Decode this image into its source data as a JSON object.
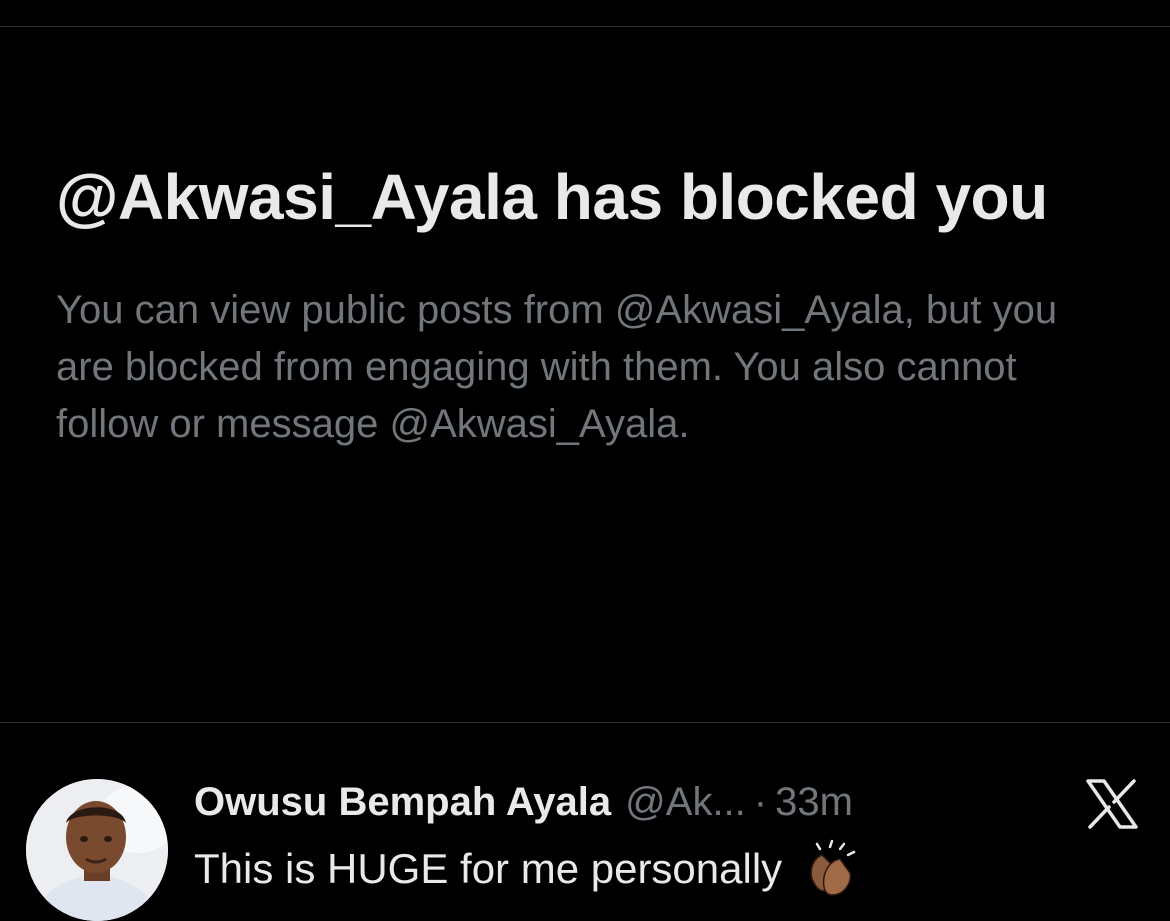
{
  "blocked_notice": {
    "title": "@Akwasi_Ayala has blocked you",
    "description": "You can view public posts from @Akwasi_Ayala, but you are blocked from engaging with them. You also cannot follow or message @Akwasi_Ayala."
  },
  "post": {
    "author_name": "Owusu Bempah Ayala",
    "author_handle": "@Ak...",
    "separator": "·",
    "time": "33m",
    "text": "This is HUGE for me personally",
    "emoji_icon": "clapping-hands-medium-dark-skin-icon",
    "platform_icon": "x-logo-icon"
  },
  "colors": {
    "background": "#000000",
    "primary_text": "#e7e9ea",
    "secondary_text": "#71767b",
    "divider": "#2f3336"
  }
}
